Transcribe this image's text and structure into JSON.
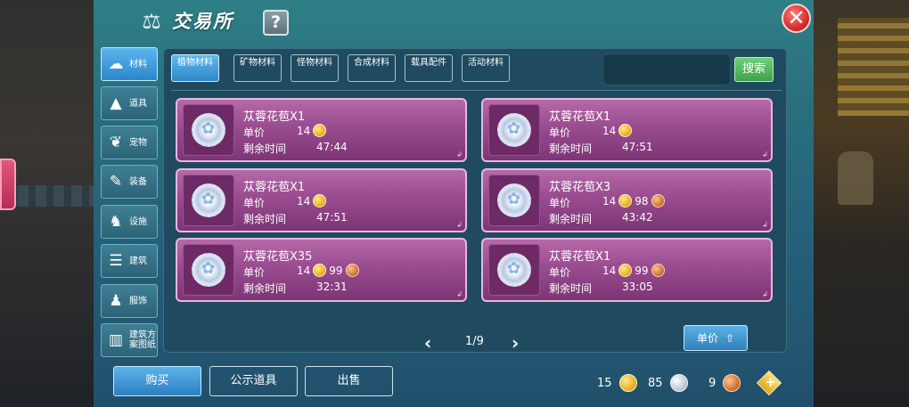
{
  "title": "交易所",
  "help": "?",
  "close": "✕",
  "sidebar": {
    "items": [
      {
        "label": "材料",
        "icon": "materials-icon"
      },
      {
        "label": "道具",
        "icon": "tools-icon"
      },
      {
        "label": "宠物",
        "icon": "paw-icon"
      },
      {
        "label": "装备",
        "icon": "equipment-icon"
      },
      {
        "label": "设施",
        "icon": "facility-icon"
      },
      {
        "label": "建筑",
        "icon": "building-icon"
      },
      {
        "label": "服饰",
        "icon": "clothing-icon"
      },
      {
        "label": "建筑方案图纸",
        "icon": "blueprint-icon"
      }
    ],
    "active": 0
  },
  "tabs": [
    {
      "label": "植物材料"
    },
    {
      "label": "矿物材料"
    },
    {
      "label": "怪物材料"
    },
    {
      "label": "合成材料"
    },
    {
      "label": "载具配件"
    },
    {
      "label": "活动材料"
    }
  ],
  "search": {
    "button": "搜索",
    "placeholder": ""
  },
  "listing_labels": {
    "price": "单价",
    "time": "剩余时间"
  },
  "listings": [
    {
      "name": "苁蓉花苞X1",
      "gold": "14",
      "copper": "",
      "time": "47:44"
    },
    {
      "name": "苁蓉花苞X1",
      "gold": "14",
      "copper": "",
      "time": "47:51"
    },
    {
      "name": "苁蓉花苞X1",
      "gold": "14",
      "copper": "",
      "time": "47:51"
    },
    {
      "name": "苁蓉花苞X3",
      "gold": "14",
      "copper": "98",
      "time": "43:42"
    },
    {
      "name": "苁蓉花苞X35",
      "gold": "14",
      "copper": "99",
      "time": "32:31"
    },
    {
      "name": "苁蓉花苞X1",
      "gold": "14",
      "copper": "99",
      "time": "33:05"
    }
  ],
  "pager": {
    "prev": "‹",
    "next": "›",
    "text": "1/9"
  },
  "sort": {
    "label": "单价"
  },
  "bottom": {
    "buy": "购买",
    "announce": "公示道具",
    "sell": "出售"
  },
  "currency": {
    "gold": "15",
    "silver": "85",
    "copper": "9"
  },
  "colors": {
    "card": "#9c4e92",
    "accent": "#2e86c6",
    "gold": "#e4a91a",
    "copper": "#c66a2f"
  }
}
